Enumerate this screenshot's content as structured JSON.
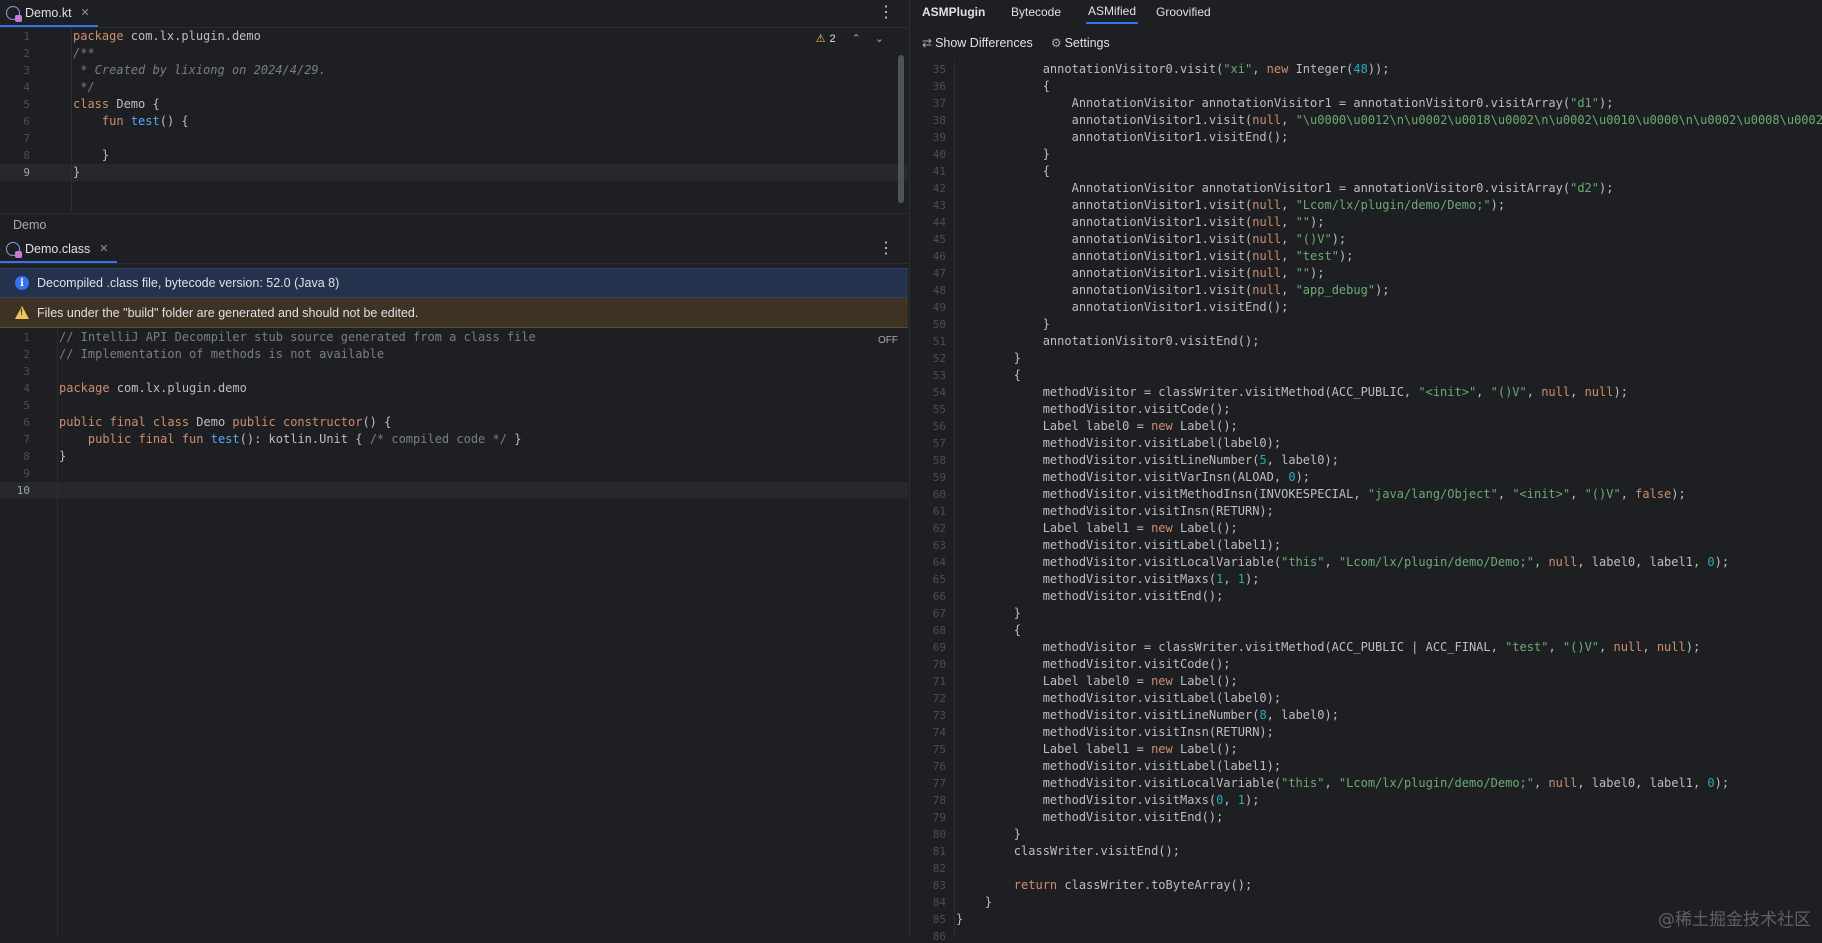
{
  "top_editor": {
    "tab_label": "Demo.kt",
    "warning_count": "2",
    "line_numbers": [
      "1",
      "2",
      "3",
      "4",
      "5",
      "6",
      "7",
      "8",
      "9"
    ],
    "current_line": 9,
    "lines": [
      [
        [
          "kw",
          "package "
        ],
        [
          "cls",
          "com.lx.plugin.demo"
        ]
      ],
      [
        [
          "cmt",
          "/**"
        ]
      ],
      [
        [
          "cmt",
          " * Created by lixiong on 2024/4/29."
        ]
      ],
      [
        [
          "cmt",
          " */"
        ]
      ],
      [
        [
          "kw",
          "class "
        ],
        [
          "cls",
          "Demo "
        ],
        [
          "cls",
          "{"
        ]
      ],
      [
        [
          "cls",
          "    "
        ],
        [
          "kw",
          "fun "
        ],
        [
          "fn",
          "test"
        ],
        [
          "cls",
          "() {"
        ]
      ],
      [
        [
          "cls",
          ""
        ]
      ],
      [
        [
          "cls",
          "    }"
        ]
      ],
      [
        [
          "cls",
          "}"
        ]
      ]
    ]
  },
  "breadcrumb": "Demo",
  "bottom_editor": {
    "tab_label": "Demo.class",
    "info_banner": "Decompiled .class file, bytecode version: 52.0 (Java 8)",
    "warn_banner": "Files under the \"build\" folder are generated and should not be edited.",
    "off_label": "OFF",
    "line_numbers": [
      "1",
      "2",
      "3",
      "4",
      "5",
      "6",
      "7",
      "8",
      "9",
      "10"
    ],
    "current_line": 10,
    "lines": [
      [
        [
          "lcmt",
          "// IntelliJ API Decompiler stub source generated from a class file"
        ]
      ],
      [
        [
          "lcmt",
          "// Implementation of methods is not available"
        ]
      ],
      [
        [
          "cls",
          ""
        ]
      ],
      [
        [
          "kw",
          "package "
        ],
        [
          "cls",
          "com.lx.plugin.demo"
        ]
      ],
      [
        [
          "cls",
          ""
        ]
      ],
      [
        [
          "kw",
          "public final class "
        ],
        [
          "cls",
          "Demo "
        ],
        [
          "kw",
          "public constructor"
        ],
        [
          "cls",
          "() {"
        ]
      ],
      [
        [
          "cls",
          "    "
        ],
        [
          "kw",
          "public final fun "
        ],
        [
          "fn",
          "test"
        ],
        [
          "cls",
          "(): kotlin.Unit { "
        ],
        [
          "lcmt",
          "/* compiled code */"
        ],
        [
          "cls",
          " }"
        ]
      ],
      [
        [
          "cls",
          "}"
        ]
      ],
      [
        [
          "cls",
          ""
        ]
      ],
      [
        [
          "cls",
          ""
        ]
      ]
    ]
  },
  "right_panel": {
    "title": "ASMPlugin",
    "tabs": [
      "Bytecode",
      "ASMified",
      "Groovified"
    ],
    "selected_tab": "ASMified",
    "show_differences": "Show Differences",
    "settings": "Settings",
    "watermark": "@稀土掘金技术社区",
    "line_numbers": [
      "35",
      "36",
      "37",
      "38",
      "39",
      "40",
      "41",
      "42",
      "43",
      "44",
      "45",
      "46",
      "47",
      "48",
      "49",
      "50",
      "51",
      "52",
      "53",
      "54",
      "55",
      "56",
      "57",
      "58",
      "59",
      "60",
      "61",
      "62",
      "63",
      "64",
      "65",
      "66",
      "67",
      "68",
      "69",
      "70",
      "71",
      "72",
      "73",
      "74",
      "75",
      "76",
      "77",
      "78",
      "79",
      "80",
      "81",
      "82",
      "83",
      "84",
      "85",
      "86"
    ],
    "lines": [
      [
        [
          "cls",
          "            annotationVisitor0.visit("
        ],
        [
          "str",
          "\"xi\""
        ],
        [
          "cls",
          ", "
        ],
        [
          "kw",
          "new "
        ],
        [
          "cls",
          "Integer("
        ],
        [
          "num",
          "48"
        ],
        [
          "cls",
          "));"
        ]
      ],
      [
        [
          "cls",
          "            {"
        ]
      ],
      [
        [
          "cls",
          "                AnnotationVisitor annotationVisitor1 = annotationVisitor0.visitArray("
        ],
        [
          "str",
          "\"d1\""
        ],
        [
          "cls",
          ");"
        ]
      ],
      [
        [
          "cls",
          "                annotationVisitor1.visit("
        ],
        [
          "nul",
          "null"
        ],
        [
          "cls",
          ", "
        ],
        [
          "str",
          "\"\\u0000\\u0012\\n\\u0002\\u0018\\u0002\\n\\u0002\\u0010\\u0000\\n\\u0002\\u0008\\u0002"
        ]
      ],
      [
        [
          "cls",
          "                annotationVisitor1.visitEnd();"
        ]
      ],
      [
        [
          "cls",
          "            }"
        ]
      ],
      [
        [
          "cls",
          "            {"
        ]
      ],
      [
        [
          "cls",
          "                AnnotationVisitor annotationVisitor1 = annotationVisitor0.visitArray("
        ],
        [
          "str",
          "\"d2\""
        ],
        [
          "cls",
          ");"
        ]
      ],
      [
        [
          "cls",
          "                annotationVisitor1.visit("
        ],
        [
          "nul",
          "null"
        ],
        [
          "cls",
          ", "
        ],
        [
          "str",
          "\"Lcom/lx/plugin/demo/Demo;\""
        ],
        [
          "cls",
          ");"
        ]
      ],
      [
        [
          "cls",
          "                annotationVisitor1.visit("
        ],
        [
          "nul",
          "null"
        ],
        [
          "cls",
          ", "
        ],
        [
          "str",
          "\"\""
        ],
        [
          "cls",
          ");"
        ]
      ],
      [
        [
          "cls",
          "                annotationVisitor1.visit("
        ],
        [
          "nul",
          "null"
        ],
        [
          "cls",
          ", "
        ],
        [
          "str",
          "\"()V\""
        ],
        [
          "cls",
          ");"
        ]
      ],
      [
        [
          "cls",
          "                annotationVisitor1.visit("
        ],
        [
          "nul",
          "null"
        ],
        [
          "cls",
          ", "
        ],
        [
          "str",
          "\"test\""
        ],
        [
          "cls",
          ");"
        ]
      ],
      [
        [
          "cls",
          "                annotationVisitor1.visit("
        ],
        [
          "nul",
          "null"
        ],
        [
          "cls",
          ", "
        ],
        [
          "str",
          "\"\""
        ],
        [
          "cls",
          ");"
        ]
      ],
      [
        [
          "cls",
          "                annotationVisitor1.visit("
        ],
        [
          "nul",
          "null"
        ],
        [
          "cls",
          ", "
        ],
        [
          "str",
          "\"app_debug\""
        ],
        [
          "cls",
          ");"
        ]
      ],
      [
        [
          "cls",
          "                annotationVisitor1.visitEnd();"
        ]
      ],
      [
        [
          "cls",
          "            }"
        ]
      ],
      [
        [
          "cls",
          "            annotationVisitor0.visitEnd();"
        ]
      ],
      [
        [
          "cls",
          "        }"
        ]
      ],
      [
        [
          "cls",
          "        {"
        ]
      ],
      [
        [
          "cls",
          "            methodVisitor = classWriter.visitMethod(ACC_PUBLIC, "
        ],
        [
          "str",
          "\"<init>\""
        ],
        [
          "cls",
          ", "
        ],
        [
          "str",
          "\"()V\""
        ],
        [
          "cls",
          ", "
        ],
        [
          "nul",
          "null"
        ],
        [
          "cls",
          ", "
        ],
        [
          "nul",
          "null"
        ],
        [
          "cls",
          ");"
        ]
      ],
      [
        [
          "cls",
          "            methodVisitor.visitCode();"
        ]
      ],
      [
        [
          "cls",
          "            Label label0 = "
        ],
        [
          "kw",
          "new "
        ],
        [
          "cls",
          "Label();"
        ]
      ],
      [
        [
          "cls",
          "            methodVisitor.visitLabel(label0);"
        ]
      ],
      [
        [
          "cls",
          "            methodVisitor.visitLineNumber("
        ],
        [
          "num",
          "5"
        ],
        [
          "cls",
          ", label0);"
        ]
      ],
      [
        [
          "cls",
          "            methodVisitor.visitVarInsn(ALOAD, "
        ],
        [
          "num",
          "0"
        ],
        [
          "cls",
          ");"
        ]
      ],
      [
        [
          "cls",
          "            methodVisitor.visitMethodInsn(INVOKESPECIAL, "
        ],
        [
          "str",
          "\"java/lang/Object\""
        ],
        [
          "cls",
          ", "
        ],
        [
          "str",
          "\"<init>\""
        ],
        [
          "cls",
          ", "
        ],
        [
          "str",
          "\"()V\""
        ],
        [
          "cls",
          ", "
        ],
        [
          "kw",
          "false"
        ],
        [
          "cls",
          ");"
        ]
      ],
      [
        [
          "cls",
          "            methodVisitor.visitInsn(RETURN);"
        ]
      ],
      [
        [
          "cls",
          "            Label label1 = "
        ],
        [
          "kw",
          "new "
        ],
        [
          "cls",
          "Label();"
        ]
      ],
      [
        [
          "cls",
          "            methodVisitor.visitLabel(label1);"
        ]
      ],
      [
        [
          "cls",
          "            methodVisitor.visitLocalVariable("
        ],
        [
          "str",
          "\"this\""
        ],
        [
          "cls",
          ", "
        ],
        [
          "str",
          "\"Lcom/lx/plugin/demo/Demo;\""
        ],
        [
          "cls",
          ", "
        ],
        [
          "nul",
          "null"
        ],
        [
          "cls",
          ", label0, label1, "
        ],
        [
          "num",
          "0"
        ],
        [
          "cls",
          ");"
        ]
      ],
      [
        [
          "cls",
          "            methodVisitor.visitMaxs("
        ],
        [
          "num",
          "1"
        ],
        [
          "cls",
          ", "
        ],
        [
          "num",
          "1"
        ],
        [
          "cls",
          ");"
        ]
      ],
      [
        [
          "cls",
          "            methodVisitor.visitEnd();"
        ]
      ],
      [
        [
          "cls",
          "        }"
        ]
      ],
      [
        [
          "cls",
          "        {"
        ]
      ],
      [
        [
          "cls",
          "            methodVisitor = classWriter.visitMethod(ACC_PUBLIC | ACC_FINAL, "
        ],
        [
          "str",
          "\"test\""
        ],
        [
          "cls",
          ", "
        ],
        [
          "str",
          "\"()V\""
        ],
        [
          "cls",
          ", "
        ],
        [
          "nul",
          "null"
        ],
        [
          "cls",
          ", "
        ],
        [
          "nul",
          "null"
        ],
        [
          "cls",
          ");"
        ]
      ],
      [
        [
          "cls",
          "            methodVisitor.visitCode();"
        ]
      ],
      [
        [
          "cls",
          "            Label label0 = "
        ],
        [
          "kw",
          "new "
        ],
        [
          "cls",
          "Label();"
        ]
      ],
      [
        [
          "cls",
          "            methodVisitor.visitLabel(label0);"
        ]
      ],
      [
        [
          "cls",
          "            methodVisitor.visitLineNumber("
        ],
        [
          "num",
          "8"
        ],
        [
          "cls",
          ", label0);"
        ]
      ],
      [
        [
          "cls",
          "            methodVisitor.visitInsn(RETURN);"
        ]
      ],
      [
        [
          "cls",
          "            Label label1 = "
        ],
        [
          "kw",
          "new "
        ],
        [
          "cls",
          "Label();"
        ]
      ],
      [
        [
          "cls",
          "            methodVisitor.visitLabel(label1);"
        ]
      ],
      [
        [
          "cls",
          "            methodVisitor.visitLocalVariable("
        ],
        [
          "str",
          "\"this\""
        ],
        [
          "cls",
          ", "
        ],
        [
          "str",
          "\"Lcom/lx/plugin/demo/Demo;\""
        ],
        [
          "cls",
          ", "
        ],
        [
          "nul",
          "null"
        ],
        [
          "cls",
          ", label0, label1, "
        ],
        [
          "num",
          "0"
        ],
        [
          "cls",
          ");"
        ]
      ],
      [
        [
          "cls",
          "            methodVisitor.visitMaxs("
        ],
        [
          "num",
          "0"
        ],
        [
          "cls",
          ", "
        ],
        [
          "num",
          "1"
        ],
        [
          "cls",
          ");"
        ]
      ],
      [
        [
          "cls",
          "            methodVisitor.visitEnd();"
        ]
      ],
      [
        [
          "cls",
          "        }"
        ]
      ],
      [
        [
          "cls",
          "        classWriter.visitEnd();"
        ]
      ],
      [
        [
          "cls",
          ""
        ]
      ],
      [
        [
          "cls",
          "        "
        ],
        [
          "kw",
          "return "
        ],
        [
          "cls",
          "classWriter.toByteArray();"
        ]
      ],
      [
        [
          "cls",
          "    }"
        ]
      ],
      [
        [
          "cls",
          "}"
        ]
      ],
      [
        [
          "cls",
          ""
        ]
      ]
    ]
  }
}
